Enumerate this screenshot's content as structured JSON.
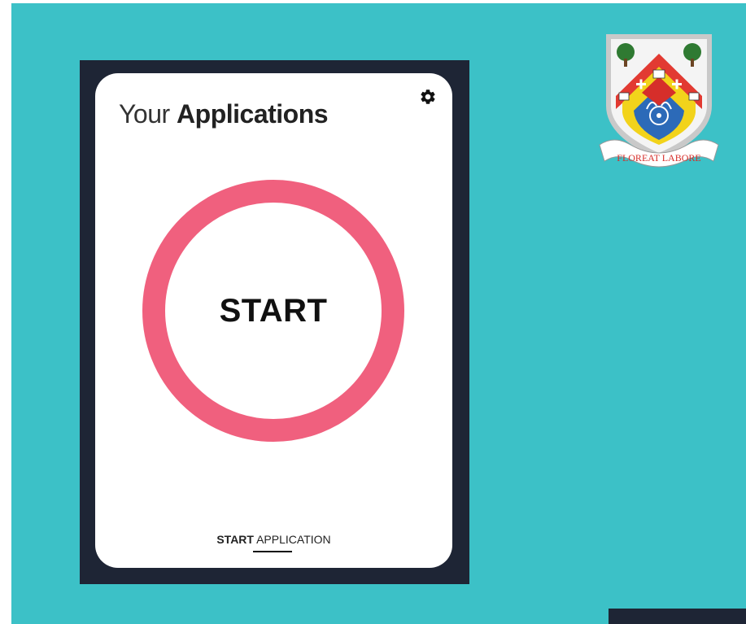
{
  "card": {
    "title_light": "Your",
    "title_bold": "Applications",
    "start_label": "START",
    "bottom_link_bold": "START",
    "bottom_link_rest": "APPLICATION"
  },
  "crest": {
    "motto": "FLOREAT LABORE"
  },
  "colors": {
    "background": "#3cc1c7",
    "frame": "#1e2535",
    "ring": "#f0607e",
    "card": "#ffffff"
  },
  "icons": {
    "settings": "gear-icon"
  }
}
